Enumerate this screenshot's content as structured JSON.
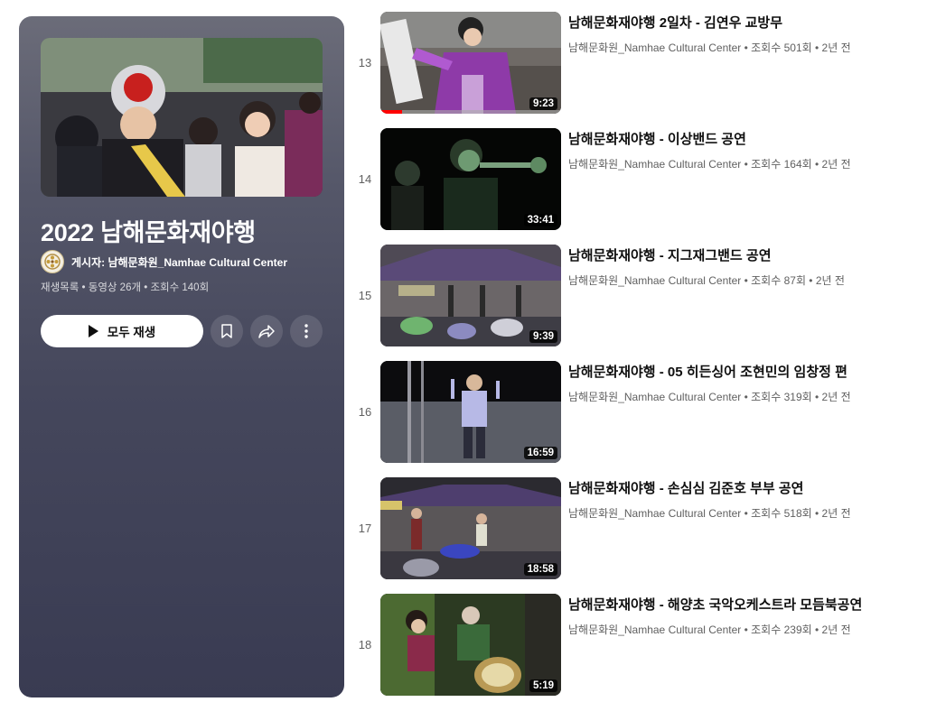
{
  "playlist": {
    "title": "2022 남해문화재야행",
    "owner_label": "게시자: 남해문화원_Namhae Cultural Center",
    "meta": "재생목록 • 동영상 26개 • 조회수 140회",
    "play_all_label": "모두 재생",
    "icons": [
      "bookmark-icon",
      "share-icon",
      "more-vert-icon",
      "play-icon"
    ]
  },
  "videos": [
    {
      "index": "13",
      "title": "남해문화재야행 2일차 - 김연우 교방무",
      "meta": "남해문화원_Namhae Cultural Center • 조회수 501회 • 2년 전",
      "duration": "9:23",
      "watched_fraction": 0.12
    },
    {
      "index": "14",
      "title": "남해문화재야행 - 이상밴드 공연",
      "meta": "남해문화원_Namhae Cultural Center • 조회수 164회 • 2년 전",
      "duration": "33:41"
    },
    {
      "index": "15",
      "title": "남해문화재야행 - 지그재그밴드 공연",
      "meta": "남해문화원_Namhae Cultural Center • 조회수 87회 • 2년 전",
      "duration": "9:39"
    },
    {
      "index": "16",
      "title": "남해문화재야행 - 05 히든싱어 조현민의 임창정 편",
      "meta": "남해문화원_Namhae Cultural Center • 조회수 319회 • 2년 전",
      "duration": "16:59"
    },
    {
      "index": "17",
      "title": "남해문화재야행 - 손심심 김준호 부부 공연",
      "meta": "남해문화원_Namhae Cultural Center • 조회수 518회 • 2년 전",
      "duration": "18:58"
    },
    {
      "index": "18",
      "title": "남해문화재야행 - 해양초 국악오케스트라 모듬북공연",
      "meta": "남해문화원_Namhae Cultural Center • 조회수 239회 • 2년 전",
      "duration": "5:19"
    }
  ],
  "colors": {
    "progress": "#ff0000",
    "panel_top": "#6b6c79",
    "panel_bottom": "#393b52"
  }
}
